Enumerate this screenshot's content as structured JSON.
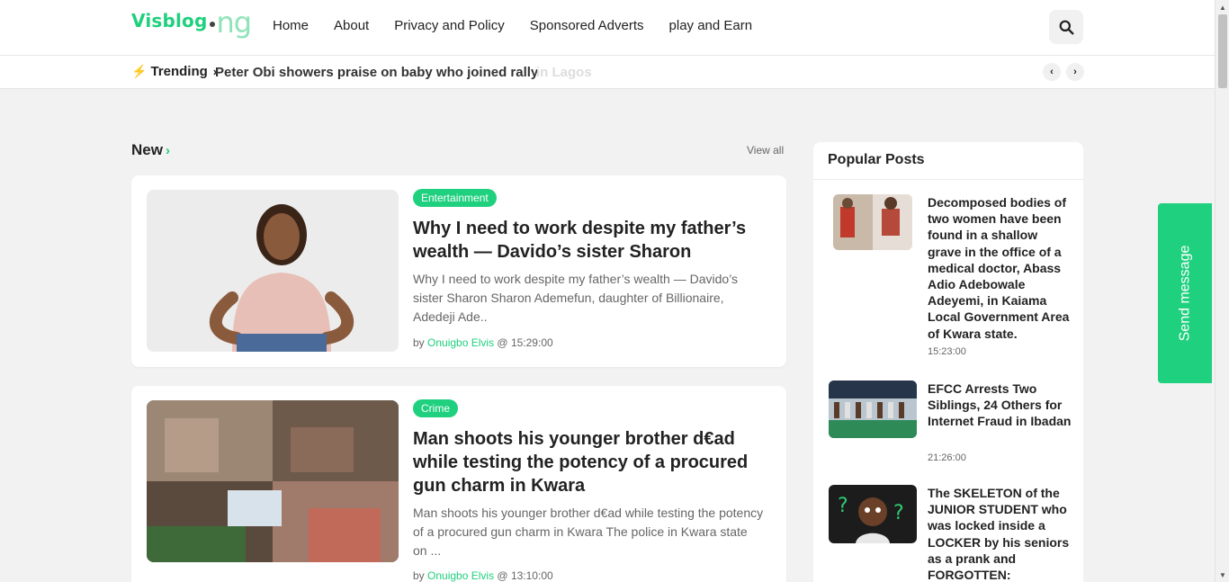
{
  "header": {
    "logo_main": "Visblog",
    "logo_tld": "ng",
    "nav": [
      "Home",
      "About",
      "Privacy and Policy",
      "Sponsored Adverts",
      "play and Earn"
    ]
  },
  "trending": {
    "label": "Trending",
    "headline": "Peter Obi showers praise on baby who joined rally",
    "ghost": "in Lagos"
  },
  "section": {
    "title": "New",
    "view_all": "View all"
  },
  "posts": [
    {
      "category": "Entertainment",
      "title": "Why I need to work despite my father’s wealth — Davido’s sister Sharon",
      "excerpt": "Why I need to work despite my father’s wealth — Davido’s sister Sharon Sharon Ademefun, daughter of Billionaire, Adedeji Ade..",
      "by": "by",
      "author": "Onuigbo Elvis",
      "at": "@",
      "time": "15:29:00"
    },
    {
      "category": "Crime",
      "title": "Man shoots his younger brother d€ad while testing the potency of a procured gun charm in Kwara",
      "excerpt": "Man shoots his younger brother d€ad while testing the potency of a procured gun charm in Kwara The police in Kwara state on ...",
      "by": "by",
      "author": "Onuigbo Elvis",
      "at": "@",
      "time": "13:10:00"
    }
  ],
  "sidebar": {
    "title": "Popular Posts",
    "items": [
      {
        "title": "Decomposed bodies of two women have been found in a shallow grave in the office of a medical doctor, Abass Adio Adebowale Adeyemi, in Kaiama Local Government Area of Kwara state.",
        "time": "15:23:00"
      },
      {
        "title": "EFCC Arrests Two Siblings, 24 Others for Internet Fraud in Ibadan",
        "time": "21:26:00"
      },
      {
        "title": "The SKELETON of the JUNIOR STUDENT who was locked inside a LOCKER by his seniors as a prank and FORGOTTEN:",
        "time": ""
      }
    ]
  },
  "send_message": "Send message",
  "colors": {
    "accent": "#1fd07e",
    "background": "#f2f2f2"
  }
}
